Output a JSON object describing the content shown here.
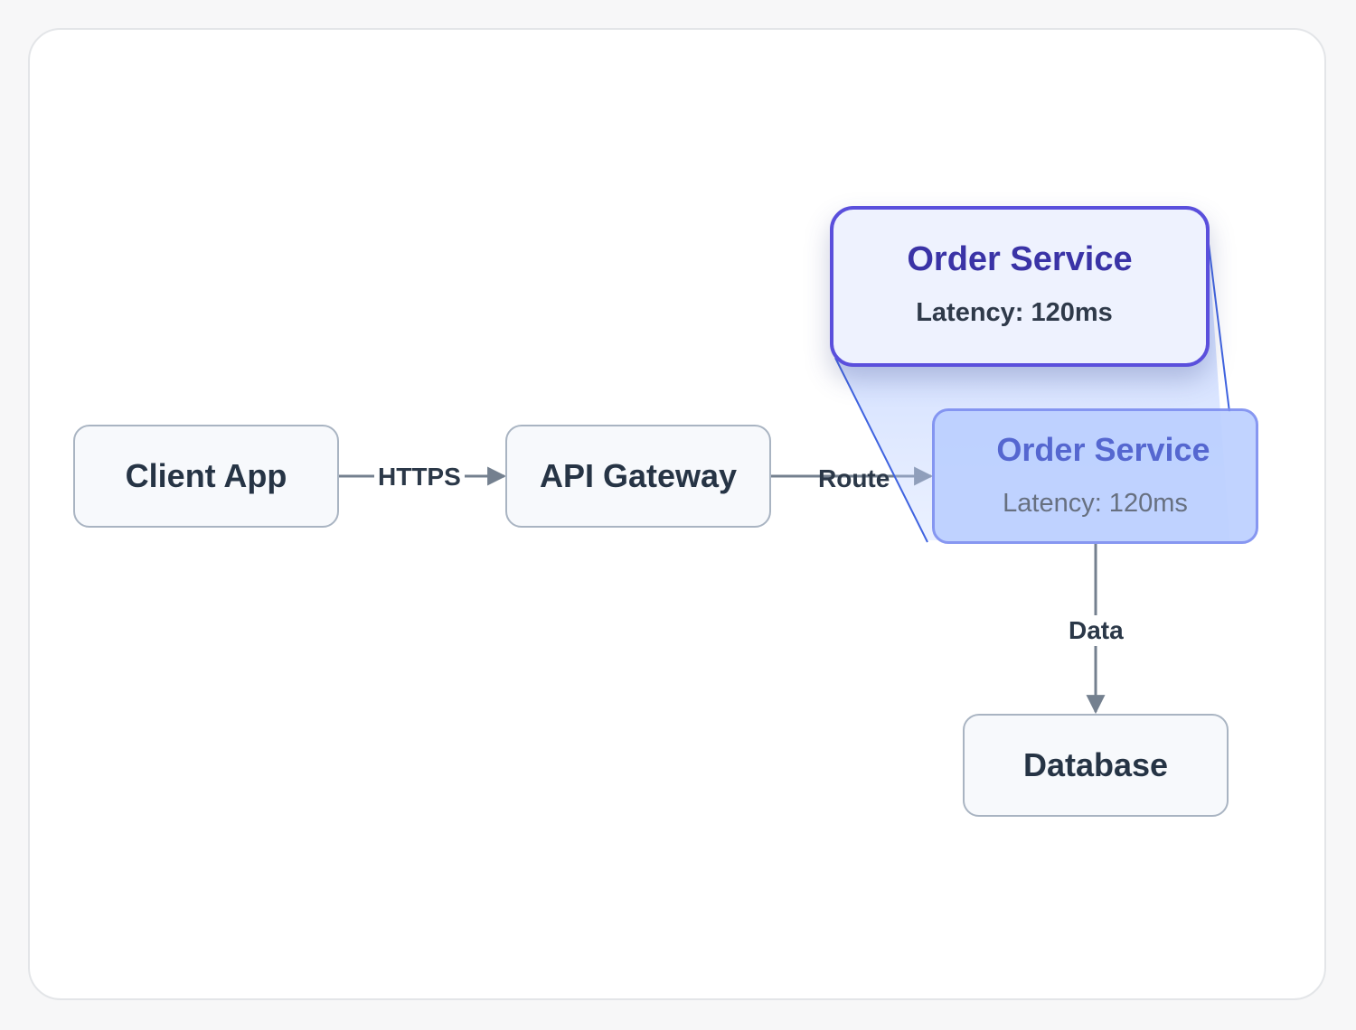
{
  "nodes": {
    "client": "Client App",
    "gateway": "API Gateway",
    "order": {
      "title": "Order Service",
      "subtitle": "Latency: 120ms"
    },
    "database": "Database"
  },
  "edges": {
    "client_gateway": "HTTPS",
    "gateway_order": "Route",
    "order_database": "Data"
  },
  "zoom": {
    "title": "Order Service",
    "subtitle": "Latency: 120ms"
  },
  "colors": {
    "edge": "#74808f",
    "node_border": "#a9b4c2",
    "highlight": "#5a4fdc",
    "highlight_fill": "#bcd0ff"
  }
}
